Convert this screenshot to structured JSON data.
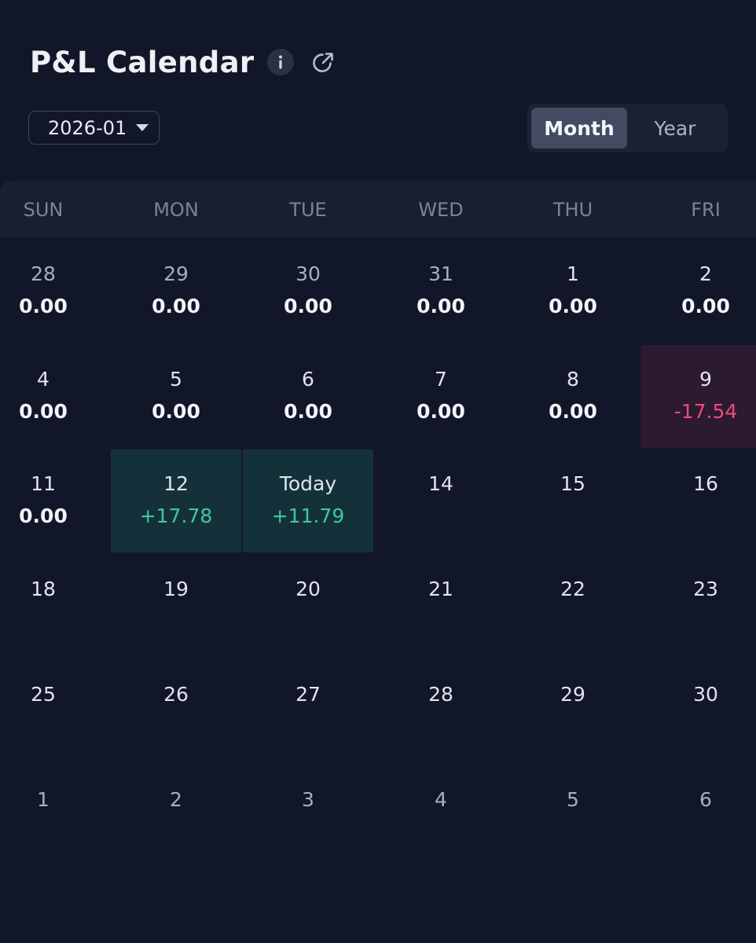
{
  "header": {
    "title": "P&L Calendar",
    "info_icon": "info-icon",
    "external_link_icon": "external-link-icon"
  },
  "month_select": {
    "value": "2026-01",
    "icon": "caret-down-icon"
  },
  "view_toggle": {
    "options": [
      "Month",
      "Year"
    ],
    "selected": "Month"
  },
  "weekdays": [
    "SUN",
    "MON",
    "TUE",
    "WED",
    "THU",
    "FRI"
  ],
  "colors": {
    "background": "#121629",
    "positive": "#43c79a",
    "negative": "#ee4a7a",
    "positive_bg": "#14313a",
    "negative_bg": "#2c1a30"
  },
  "weeks": [
    [
      {
        "day": "28",
        "pnl": "0.00",
        "kind": "prev"
      },
      {
        "day": "29",
        "pnl": "0.00",
        "kind": "prev"
      },
      {
        "day": "30",
        "pnl": "0.00",
        "kind": "prev"
      },
      {
        "day": "31",
        "pnl": "0.00",
        "kind": "prev"
      },
      {
        "day": "1",
        "pnl": "0.00",
        "kind": "current"
      },
      {
        "day": "2",
        "pnl": "0.00",
        "kind": "current"
      }
    ],
    [
      {
        "day": "4",
        "pnl": "0.00",
        "kind": "current"
      },
      {
        "day": "5",
        "pnl": "0.00",
        "kind": "current"
      },
      {
        "day": "6",
        "pnl": "0.00",
        "kind": "current"
      },
      {
        "day": "7",
        "pnl": "0.00",
        "kind": "current"
      },
      {
        "day": "8",
        "pnl": "0.00",
        "kind": "current"
      },
      {
        "day": "9",
        "pnl": "-17.54",
        "kind": "current",
        "tone": "negative"
      }
    ],
    [
      {
        "day": "11",
        "pnl": "0.00",
        "kind": "current"
      },
      {
        "day": "12",
        "pnl": "+17.78",
        "kind": "current",
        "tone": "positive"
      },
      {
        "day": "Today",
        "pnl": "+11.79",
        "kind": "current",
        "tone": "positive"
      },
      {
        "day": "14",
        "kind": "current"
      },
      {
        "day": "15",
        "kind": "current"
      },
      {
        "day": "16",
        "kind": "current"
      }
    ],
    [
      {
        "day": "18",
        "kind": "current"
      },
      {
        "day": "19",
        "kind": "current"
      },
      {
        "day": "20",
        "kind": "current"
      },
      {
        "day": "21",
        "kind": "current"
      },
      {
        "day": "22",
        "kind": "current"
      },
      {
        "day": "23",
        "kind": "current"
      }
    ],
    [
      {
        "day": "25",
        "kind": "current"
      },
      {
        "day": "26",
        "kind": "current"
      },
      {
        "day": "27",
        "kind": "current"
      },
      {
        "day": "28",
        "kind": "current"
      },
      {
        "day": "29",
        "kind": "current"
      },
      {
        "day": "30",
        "kind": "current"
      }
    ],
    [
      {
        "day": "1",
        "kind": "next"
      },
      {
        "day": "2",
        "kind": "next"
      },
      {
        "day": "3",
        "kind": "next"
      },
      {
        "day": "4",
        "kind": "next"
      },
      {
        "day": "5",
        "kind": "next"
      },
      {
        "day": "6",
        "kind": "next"
      }
    ]
  ]
}
